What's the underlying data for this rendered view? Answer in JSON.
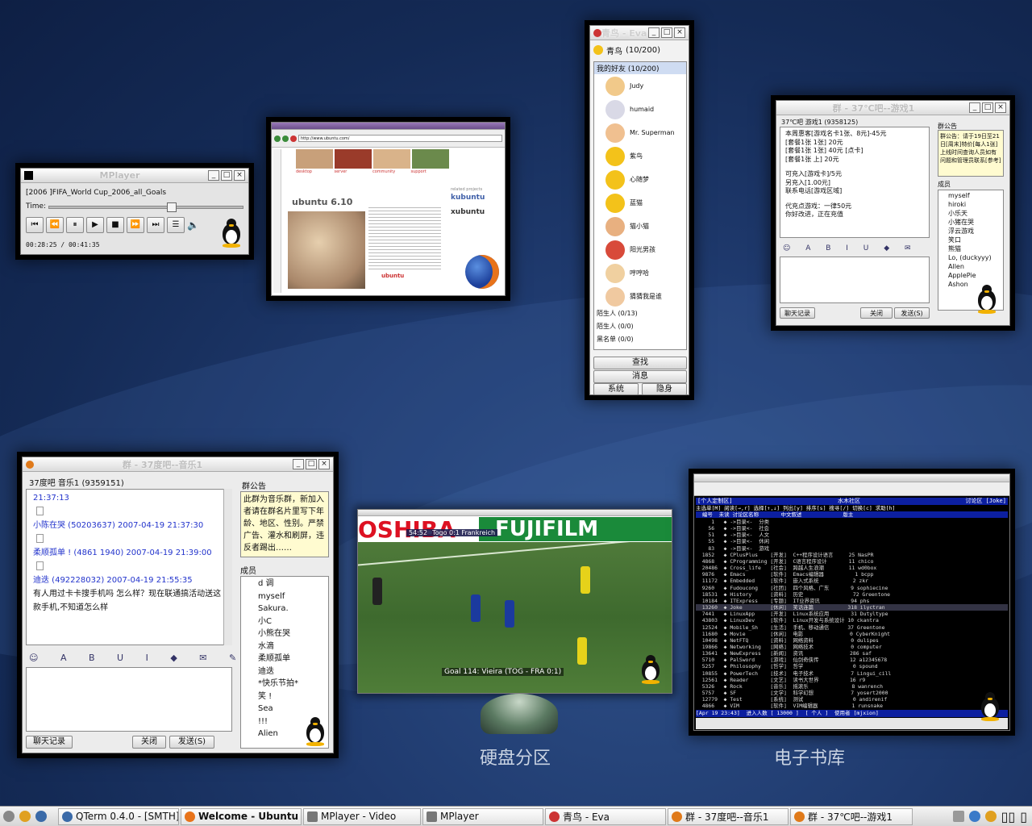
{
  "mplayer": {
    "title": "MPlayer",
    "file": "[2006                        ]FIFA_World Cup_2006_all_Goals",
    "time_label": "Time:",
    "time": "00:28:25 / 00:41:35"
  },
  "browser": {
    "title": "Welcome - Ubuntu",
    "url": "http://www.ubuntu.com/",
    "nav": [
      "desktop",
      "server",
      "community",
      "support"
    ],
    "heading": "ubuntu 6.10",
    "related_label": "related projects",
    "related": [
      "kubuntu",
      "xubuntu"
    ],
    "footer_logo": "ubuntu"
  },
  "eva": {
    "title": "青鸟 - Eva",
    "user": "青鸟",
    "user_count": "(10/200)",
    "group_open": "我的好友 (10/200)",
    "friends": [
      "Judy",
      "humaid",
      "Mr. Superman",
      "紫鸟",
      "心随梦",
      "蓝猫",
      "猫小猫",
      "阳光男孩",
      "哼哼哈",
      "猜猜我是谁"
    ],
    "groups": [
      "陌生人 (0/13)",
      "陌生人 (0/0)",
      "黑名单 (0/0)"
    ],
    "btn_search": "查找",
    "btn_msg": "消息",
    "btn_system": "系统",
    "btn_status": "隐身"
  },
  "qun_right": {
    "title": "群 - 37℃吧--游戏1",
    "group": "37℃吧 游戏1 (9358125)",
    "messages": [
      "本周惠客[游戏名卡1张、8元]-45元",
      "[套餐1张 1张] 20元",
      "[套餐1张 1张] 40元 [点卡]",
      "[套餐1张 上] 20元",
      "可充入[游戏卡]/5元",
      "另充入[1.00元]",
      "联系电话[游戏区域]",
      "代充点游戏：一律50元",
      "你好改进，正在充值"
    ],
    "notice_title": "群公告",
    "notice": "群公告：请于19日至21日[周末]特价[每人1张]上线时间查询人员如有问题和管理员联系[参考]",
    "members_label": "成员",
    "members": [
      "myself",
      "hiroki",
      "小乐天",
      "小猪在哭",
      "浮云游戏",
      "笑口",
      "熊猫",
      "Lo, (duckyyy)",
      "Allen",
      "ApplePie",
      "Ashon"
    ],
    "btn_log": "聊天记录",
    "btn_close": "关闭",
    "btn_send": "发送(S)"
  },
  "qun_left": {
    "title": "群 - 37度吧--音乐1",
    "group": "37度吧 音乐1 (9359151)",
    "messages": [
      {
        "head": "21:37:13",
        "body": ""
      },
      {
        "head": "小陈在哭 (50203637) 2007-04-19 21:37:30",
        "body": ""
      },
      {
        "head": "柔顺孤单 ! (4861 1940) 2007-04-19 21:39:00",
        "body": ""
      },
      {
        "head": "迪迭 (492228032) 2007-04-19 21:55:35",
        "body": "有人用过卡卡搜手机吗 怎么样？现在联通搞活动送这款手机,不知道怎么样"
      }
    ],
    "notice_title": "群公告",
    "notice": "此群为音乐群，新加入者请在群名片里写下年龄、地区、性别。严禁广告、灌水和刷屏，违反者踢出……",
    "members_label": "成员",
    "members": [
      "d 调",
      "myself",
      "Sakura.",
      "小C",
      "小熊在哭",
      "水滴",
      "柔顺孤单",
      "迪迭",
      "*快乐节拍*",
      "笑 !",
      "Sea",
      "!!!",
      "Alien"
    ],
    "btn_log": "聊天记录",
    "btn_close": "关闭",
    "btn_send": "发送(S)"
  },
  "video": {
    "title": "MPlayer - Video",
    "ad_left": "OSHIBA",
    "ad_right": "FUJIFILM",
    "score_time": "54:52",
    "score": "Togo 0:1 Frankreich",
    "caption": "Goal 114: Vieira (TOG - FRA 0:1)"
  },
  "qterm": {
    "title": "QTerm 0.4.0 - [SMTH]",
    "header_left": "[个人定制区]",
    "header_mid": "水木社区",
    "header_right": "讨论区 [Joke]",
    "help": "主选单[M] 阅读[→,r] 选择[↑,↓] 列出[y] 排序[s] 搜寻[/] 切换[c] 求助[h]",
    "colhead": "  编号  未读 讨论区名称       中文叙述             版主",
    "rows": [
      "     1   ◆ ->目录<-  分类",
      "    56   ◆ ->目录<-  社会",
      "    51   ◆ ->目录<-  人文",
      "    55   ◆ ->目录<-  休闲",
      "    83   ◆ ->目录<-  游戏",
      "  1852   ◆ CPlusPlus    [开发]  C++程序设计语言     25 NasPR",
      "  4868   ◆ CProgramming [开发]  C语言程序设计       11 chico",
      "  20486  ◆ Cross_life   [社会]  跨越人生浪潮        11 wd0box",
      "  9876   ◆ Emacs        [软件]  Emacs编辑器          1 bcpp",
      "  11172  ◆ Embedded     [软件]  嵌入式系统           2 zkr",
      "  9260   ◆ Fudoucong    [社团]  四个风格、广东       9 sophiecine",
      "  18531  ◆ History      [资料]  历史                72 Greentone",
      "  10184  ◆ ITExpress    [专题]  IT业界资讯          94 phs",
      "  13260  ◆ Joke         [休闲]  笑话连篇           318 ilyctran",
      "  7441   ◆ LinuxApp     [开发]  Linux系统应用       31 Dutyltype",
      "  43803  ◆ LinuxDev     [软件]  Linux开发与系统设计 10 ckantra",
      "  12524  ◆ Mobile_Sh    [生活]  手机、移动通信      37 Greentone",
      "  11680  ◆ Movie        [休闲]  电影               0 CyberKnight",
      "  10498  ◆ NetFTQ       [资料]  网络资料            0 dulipes",
      "  19866  ◆ Networking   [网络]  网络技术            0 computer",
      "  13641  ◆ NewExpress   [新闻]  资讯               286 saf",
      "  5710   ◆ PalSword     [游戏]  仙剑奇侠传          12 a12345678",
      "  5257   ◆ Philosophy   [哲学]  哲学                0 spound",
      "  10855  ◆ PowerTech    [技术]  电子技术            7 Lingui_cill",
      "  12561  ◆ Reader       [文艺]  读书大世界          16 r9",
      "  5326   ◆ Rock         [音乐]  摇滚乐              8 wanrench",
      "  5757   ◆ SF           [文学]  科学幻想            7 yosert2000",
      "  12779  ◆ Test         [系统]  测试                0 andirenif",
      "  4866   ◆ VIM          [软件]  VIM编辑器           1 runsnake"
    ],
    "status": "[Apr 19 23:43]  进入人数 [ 13000 ]  [ 个人 ]  使用者 [mjxion]"
  },
  "captions": {
    "disk": "硬盘分区",
    "ebook": "电子书库"
  },
  "taskbar": {
    "tasks": [
      "QTerm 0.4.0 - [SMTH]",
      "Welcome - Ubuntu",
      "MPlayer - Video",
      "MPlayer",
      "青鸟 - Eva",
      "群 - 37度吧--音乐1",
      "群 - 37℃吧--游戏1"
    ]
  },
  "colors": {
    "accent": "#1f3a6e",
    "qterm_bg": "#000000",
    "qterm_head": "#0c1fa0"
  }
}
